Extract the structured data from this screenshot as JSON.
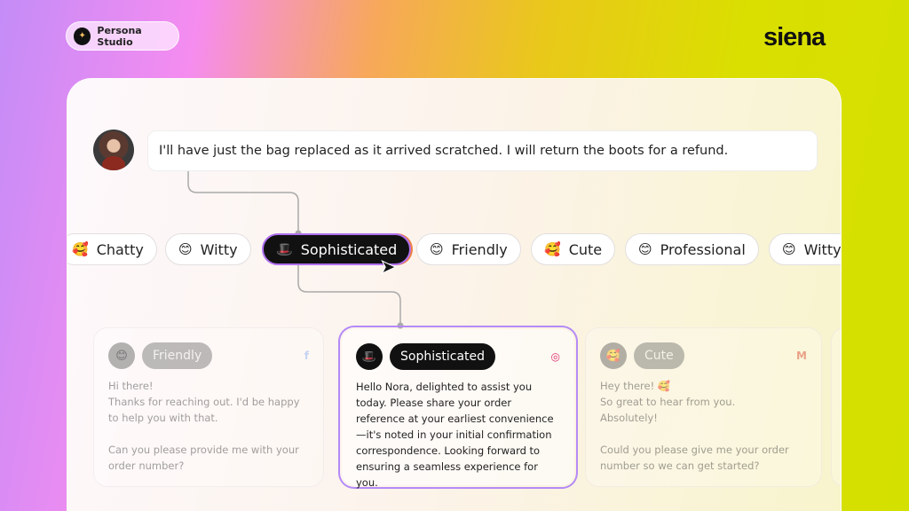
{
  "header": {
    "badge_label": "Persona Studio",
    "logo": "siena"
  },
  "message": {
    "text": "I'll have just the bag replaced as it arrived scratched. I will return the boots for a refund."
  },
  "personas": [
    {
      "emoji": "🥰",
      "label": "Chatty"
    },
    {
      "emoji": "😊",
      "label": "Witty"
    },
    {
      "emoji": "🎩",
      "label": "Sophisticated",
      "selected": true
    },
    {
      "emoji": "😊",
      "label": "Friendly"
    },
    {
      "emoji": "🥰",
      "label": "Cute"
    },
    {
      "emoji": "😊",
      "label": "Professional"
    },
    {
      "emoji": "😊",
      "label": "Witty"
    }
  ],
  "cards": [
    {
      "emoji": "😊",
      "label": "Friendly",
      "channel_icon": "facebook-icon",
      "channel_glyph": "f",
      "channel_color": "#9ab8f5",
      "text": "Hi there!\nThanks for reaching out. I'd be happy to help you with that.\n\nCan you please provide me with your order number?"
    },
    {
      "emoji": "🎩",
      "label": "Sophisticated",
      "channel_icon": "instagram-icon",
      "channel_glyph": "◎",
      "channel_color": "#e0306f",
      "text": "Hello Nora, delighted to assist you today. Please share your order reference at your earliest convenience—it's noted in your initial confirmation correspondence. Looking forward to ensuring a seamless experience for you."
    },
    {
      "emoji": "🥰",
      "label": "Cute",
      "channel_icon": "gmail-icon",
      "channel_glyph": "M",
      "channel_color": "#e06050",
      "text": "Hey there! 🥰\nSo great to hear from you.\nAbsolutely!\n\nCould you please give me your order number so we can get started?"
    }
  ],
  "colors": {
    "selected_border_start": "#b070f0",
    "selected_border_end": "#f08040",
    "chip_selected_bg": "#111111"
  }
}
